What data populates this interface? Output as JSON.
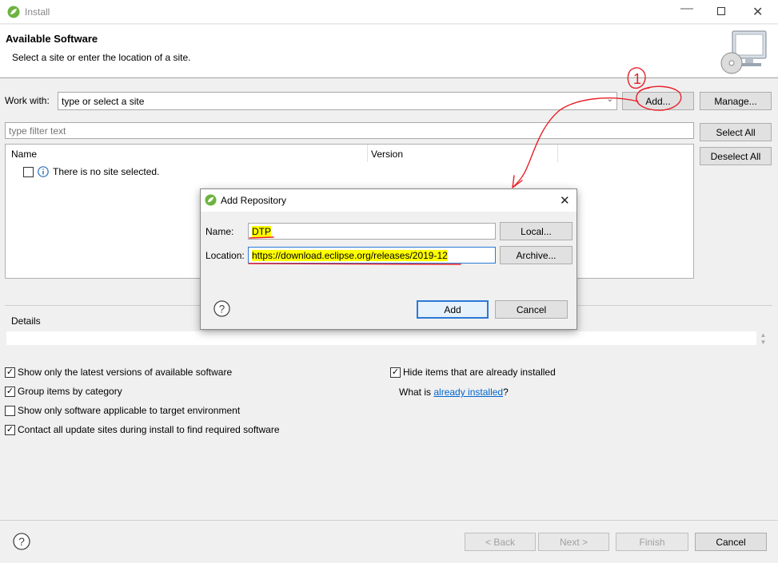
{
  "window": {
    "title": "Install"
  },
  "header": {
    "title": "Available Software",
    "subtitle": "Select a site or enter the location of a site."
  },
  "work_with": {
    "label": "Work with:",
    "placeholder": "type or select a site",
    "add_label": "Add...",
    "manage_label": "Manage..."
  },
  "filter": {
    "placeholder": "type filter text"
  },
  "table": {
    "columns": [
      "Name",
      "Version"
    ],
    "rows": [
      {
        "text": "There is no site selected."
      }
    ]
  },
  "buttons": {
    "select_all": "Select All",
    "deselect_all": "Deselect All"
  },
  "details": {
    "label": "Details"
  },
  "options": {
    "latest": {
      "label": "Show only the latest versions of available software",
      "checked": true
    },
    "group": {
      "label": "Group items by category",
      "checked": true
    },
    "applicable": {
      "label": "Show only software applicable to target environment",
      "checked": false
    },
    "contact": {
      "label": "Contact all update sites during install to find required software",
      "checked": true
    },
    "hide": {
      "label": "Hide items that are already installed",
      "checked": true
    },
    "what_is": "What is",
    "already_installed": "already installed",
    "question_mark": "?"
  },
  "footer": {
    "back": "< Back",
    "next": "Next >",
    "finish": "Finish",
    "cancel": "Cancel"
  },
  "dialog": {
    "title": "Add Repository",
    "name_label": "Name:",
    "name_value": "DTP",
    "location_label": "Location:",
    "location_value": "https://download.eclipse.org/releases/2019-12",
    "local": "Local...",
    "archive": "Archive...",
    "add": "Add",
    "cancel": "Cancel"
  },
  "annotations": {
    "number": "1"
  },
  "colors": {
    "accent": "#2b79d6",
    "link": "#0066cc",
    "highlight": "#ffff00",
    "annotation": "#e8202a"
  }
}
